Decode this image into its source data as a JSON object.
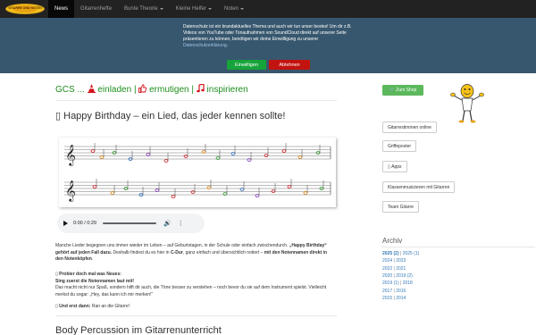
{
  "navbar": {
    "logo_text": "GITARRE UND NOTEN",
    "items": [
      {
        "label": "News",
        "active": true,
        "dropdown": false
      },
      {
        "label": "Gitarrenhefte",
        "active": false,
        "dropdown": false
      },
      {
        "label": "Bunte Theorie",
        "active": false,
        "dropdown": true
      },
      {
        "label": "Kleine Helfer",
        "active": false,
        "dropdown": true
      },
      {
        "label": "Noten",
        "active": false,
        "dropdown": true
      }
    ]
  },
  "cookie": {
    "text": "Datenschutz ist ein brandaktuelles Thema und auch wir tun unser bestes! Um dir z.B. Videos von YouTube oder Tonaufnahmen von SoundCloud direkt auf unserer Seite präsentieren zu können, benötigen wir deine Einwilligung zu unserer ",
    "link": "Datenschutzerklärung",
    "after_link": ".",
    "allow_label": "Einwilligen",
    "deny_label": "Ablehnen",
    "colors": {
      "background": "#37576e",
      "allow": "#16a43a",
      "deny": "#c3130f"
    }
  },
  "tagline": {
    "prefix": "GCS ...",
    "invite_icon": "traffic-cone-icon",
    "invite": "einladen",
    "sep1": "|",
    "encourage_icon": "thumbs-up-icon",
    "encourage": "ermutigen",
    "sep2": "|",
    "inspire_icon": "music-note-icon",
    "inspire": "inspirieren",
    "color": "#1e8e1e"
  },
  "post": {
    "title_icon": "missing-glyph-icon",
    "title": "Happy Birthday – ein Lied, das jeder kennen sollte!",
    "audio": {
      "time": "0:00 / 0:29"
    },
    "paragraph1": {
      "a": "Manche Lieder begegnen uns immer wieder im Leben – auf Geburtstagen, in der Schule oder einfach zwischendurch. ",
      "b": "„Happy Birthday“ gehört auf jeden Fall dazu.",
      "c": " Deshalb findest du es hier in ",
      "d": "C-Dur",
      "e": ", ganz einfach und übersichtlich notiert – ",
      "f": "mit den Notennamen direkt in den Notenköpfen",
      "g": "."
    },
    "paragraph2": {
      "icon": "missing-glyph-icon",
      "heading": "Probier doch mal was Neues:",
      "subheading": "Sing zuerst die Notennamen laut mit!",
      "text": "Das macht nicht nur Spaß, sondern hilft dir auch, die Töne besser zu verstehen – noch bevor du sie auf dem Instrument spielst. Vielleicht merkst du sogar: „Hey, das kann ich mir merken!“"
    },
    "paragraph3": {
      "icon": "missing-glyph-icon",
      "heading": "Und erst dann:",
      "text": " Ran an die Gitarre!"
    }
  },
  "next_post": {
    "title": "Body Percussion im Gitarrenunterricht"
  },
  "sidebar": {
    "shop_icon": "shopping-cart-icon",
    "shop_label": "Zum Shop",
    "mascot": "mascot-guitar-icon",
    "buttons": [
      {
        "label": "Gitarrestimmen online",
        "icon": ""
      },
      {
        "label": "Griffeposter",
        "icon": ""
      },
      {
        "label": "Apps",
        "icon": "mobile-icon"
      },
      {
        "label": "Klassenmusizieren mit Gitarren",
        "icon": ""
      },
      {
        "label": "Team Gitarre",
        "icon": ""
      }
    ],
    "archiv": {
      "title": "Archiv",
      "rows": [
        [
          "2025 (2)",
          "2025 (1)"
        ],
        [
          "2024",
          "2023"
        ],
        [
          "2022",
          "2021"
        ],
        [
          "2020",
          "2019 (2)"
        ],
        [
          "2019 (1)",
          "2018"
        ],
        [
          "2017",
          "2016"
        ],
        [
          "2015",
          "2014"
        ]
      ]
    }
  }
}
